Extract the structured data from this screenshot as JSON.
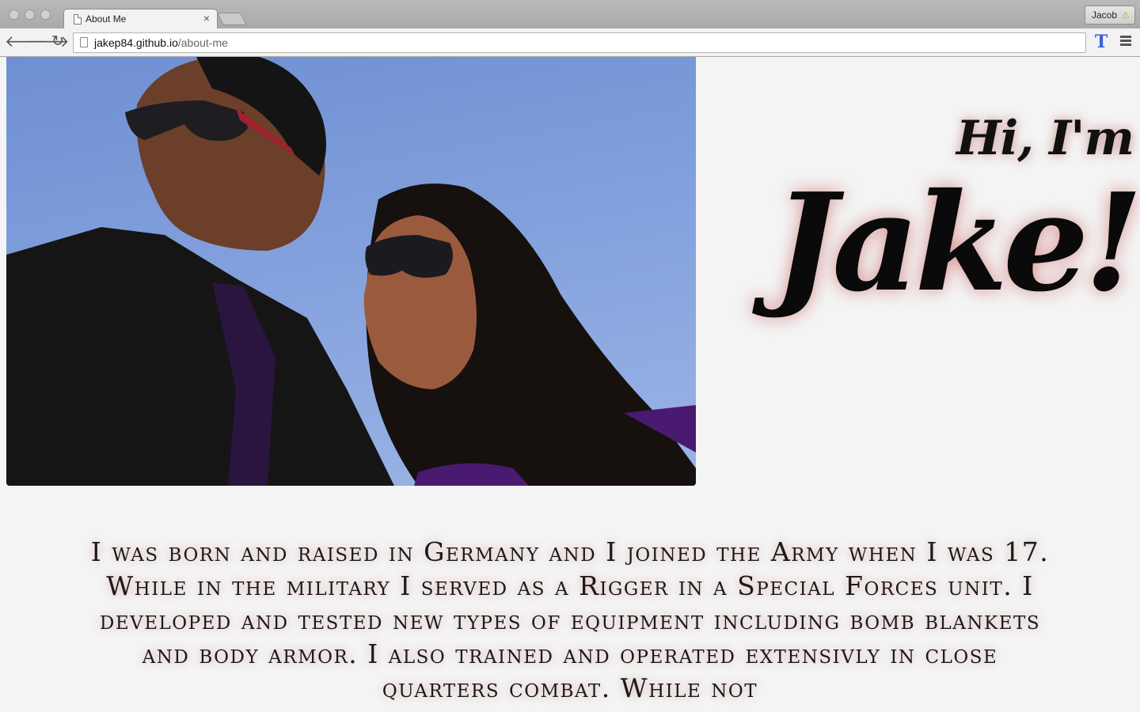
{
  "browser": {
    "tab_title": "About Me",
    "tab_close": "×",
    "profile_name": "Jacob",
    "profile_warning": "⚠",
    "url_host": "jakep84.github.io",
    "url_path": "/about-me",
    "back_icon": "back-arrow-icon",
    "forward_icon": "forward-arrow-icon",
    "reload_icon": "reload-icon",
    "extension_icon": "T"
  },
  "page": {
    "greeting": "Hi, I'm",
    "name": "Jake!",
    "photo": "selfie-photo",
    "bio": "I was born and raised in Germany and I joined the Army when I was 17. While in the military I served as a Rigger in a Special Forces unit. I developed and tested new types of equipment including bomb blankets and body armor. I also trained and operated extensivly in close quarters combat. While not"
  }
}
